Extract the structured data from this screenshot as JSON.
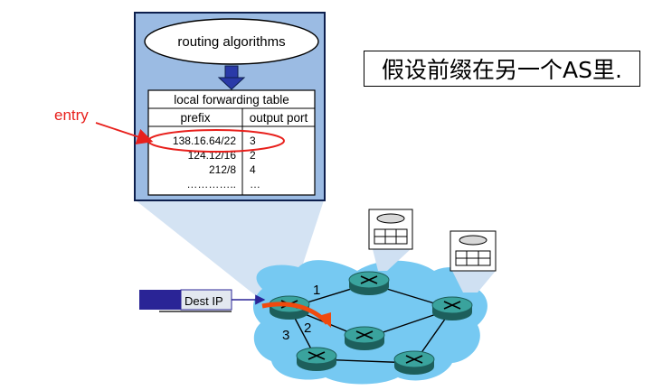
{
  "router_box": {
    "algorithms_label": "routing algorithms",
    "table": {
      "title": "local forwarding table",
      "headers": [
        "prefix",
        "output port"
      ],
      "rows": [
        {
          "prefix": "138.16.64/22",
          "port": "3"
        },
        {
          "prefix": "124.12/16",
          "port": "2"
        },
        {
          "prefix": "212/8",
          "port": "4"
        },
        {
          "prefix": "…………..",
          "port": "…"
        }
      ]
    }
  },
  "annotation": {
    "entry_label": "entry"
  },
  "caption": "假设前缀在另一个AS里.",
  "packet": {
    "label": "Dest IP"
  },
  "network": {
    "port_labels": [
      "1",
      "2",
      "3"
    ]
  },
  "colors": {
    "box_fill": "#9bbbe3",
    "box_border": "#0d1f4d",
    "cloud_fill": "#76c9f2",
    "router_fill": "#2f8f8a",
    "highlight_red": "#e8201c",
    "arrow_orange": "#f04a0e",
    "packet_fill": "#2a2496",
    "down_arrow": "#2a3aa8"
  },
  "icons": [
    "router-icon",
    "host-icon",
    "down-arrow-icon"
  ]
}
